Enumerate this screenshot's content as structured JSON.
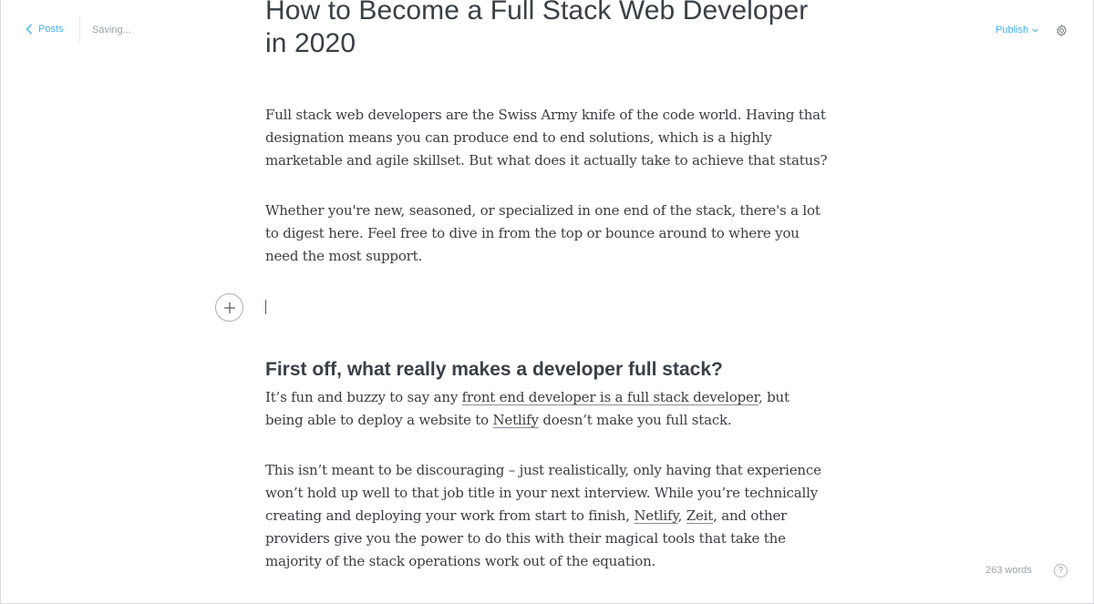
{
  "header": {
    "back_label": "Posts",
    "status": "Saving...",
    "publish_label": "Publish"
  },
  "post": {
    "title": "How to Become a Full Stack Web Developer in 2020",
    "intro_1": "Full stack web developers are the Swiss Army knife of the code world. Having that designation means you can produce end to end solutions, which is a highly marketable and agile skillset. But what does it actually take to achieve that status?",
    "intro_2": "Whether you're new, seasoned, or specialized in one end of the stack, there's a lot to digest here. Feel free to dive in from the top or bounce around to where you need the most support.",
    "section_heading": "First off, what really makes a developer full stack?",
    "p3": {
      "part_a": "It’s fun and buzzy to say any ",
      "link": "front end developer is a full stack developer",
      "part_b": ", but being able to deploy a website to ",
      "netlify": "Netlify",
      "part_c": " doesn’t make you full stack."
    },
    "p4": {
      "part_a": "This isn’t meant to be discouraging – just realistically, only having that experience won’t hold up well to that job title in your next interview. While you’re technically creating and deploying your work from start to finish, ",
      "netlify": "Netlify",
      "sep": ", ",
      "zeit": "Zeit",
      "part_b": ", and other providers give you the power to do this with their magical tools that take the majority of the stack operations work out of the equation."
    }
  },
  "footer": {
    "word_count": "263 words",
    "help_glyph": "?"
  },
  "icons": {
    "back": "chevron-left-icon",
    "publish_caret": "chevron-down-icon",
    "settings": "gear-icon",
    "add_card": "plus-icon",
    "help": "question-icon"
  },
  "colors": {
    "accent": "#3eb0ef",
    "muted": "#9aa2a9",
    "title": "#394047",
    "body": "#3a3d42"
  }
}
